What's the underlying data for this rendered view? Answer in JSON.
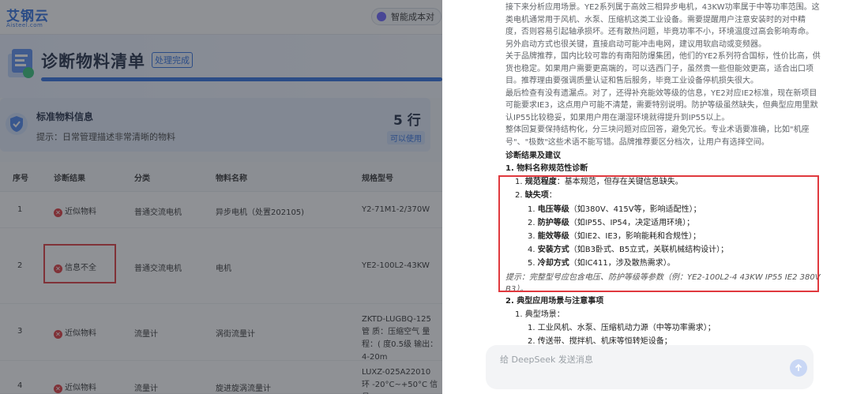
{
  "app": {
    "logo": "艾钢云",
    "logo_sub": "Aisteel.com",
    "ai_button": "智能成本对",
    "page_title": "诊断物料清单",
    "status_badge": "处理完成",
    "progress": 1.0
  },
  "info_card": {
    "title": "标准物料信息",
    "hint": "提示：日常管理描述非常清晰的物料",
    "count": "5 行",
    "usable": "可以使用"
  },
  "table": {
    "headers": [
      "序号",
      "诊断结果",
      "分类",
      "物料名称",
      "规格型号"
    ],
    "rows": [
      {
        "no": "1",
        "result": "近似物料",
        "category": "普通交流电机",
        "name": "异步电机（处置202105)",
        "spec": "Y2-71M1-2/370W"
      },
      {
        "no": "2",
        "result": "信息不全",
        "category": "普通交流电机",
        "name": "电机",
        "spec": "YE2-100L2-43KW"
      },
      {
        "no": "3",
        "result": "近似物料",
        "category": "流量计",
        "name": "涡街流量计",
        "spec": "ZKTD-LUGBQ-125 管 质：压缩空气 量程：( 度0.5级 输出：4-20m"
      },
      {
        "no": "4",
        "result": "近似物料",
        "category": "流量计",
        "name": "旋进旋涡流量计",
        "spec": "LUXZ-025A22010 环 -20°C~+50°C 信号 4"
      }
    ]
  },
  "chat": {
    "paragraphs": [
      "接下来分析应用场景。YE2系列属于高效三相异步电机，43KW功率属于中等功率范围。这",
      "类电机通常用于风机、水泵、压缩机这类工业设备。需要提醒用户注意安装时的对中精",
      "度，否则容易引起轴承损坏。还有散热问题，毕竟功率不小，环境温度过高会影响寿命。",
      "另外启动方式也很关键，直接启动可能冲击电网，建议用软启动或变频器。",
      "关于品牌推荐，国内比较可靠的有南阳防爆集团，他们的YE2系列符合国标，性价比高，供",
      "货也稳定。如果用户需要更高端的，可以选西门子，虽然贵一些但能效更高，适合出口项",
      "目。推荐理由要强调质量认证和售后服务，毕竟工业设备停机损失很大。",
      "最后检查有没有遗漏点。对了，还得补充能效等级的信息，YE2对应IE2标准，现在新项目",
      "可能要求IE3，这点用户可能不清楚，需要特别说明。防护等级虽然缺失，但典型应用里默",
      "认IP55比较稳妥，如果用户用在潮湿环境就得提升到IP55以上。",
      "整体回复要保持结构化，分三块问题对应回答，避免冗长。专业术语要准确，比如\"机座",
      "号\"、\"极数\"这些术语不能写错。品牌推荐要区分档次，让用户有选择空间。"
    ],
    "section_title": "诊断结果及建议",
    "sub1_title": "1. 物料名称规范性诊断",
    "norm_label": "规范程度",
    "norm_text": "：基本规范，但存在关键信息缺失。",
    "missing_label": "缺失项",
    "missing_items": [
      {
        "label": "电压等级",
        "text": "（如380V、415V等，影响适配性）；"
      },
      {
        "label": "防护等级",
        "text": "（如IP55、IP54，决定适用环境）；"
      },
      {
        "label": "能效等级",
        "text": "（如IE2、IE3，影响能耗和合规性）；"
      },
      {
        "label": "安装方式",
        "text": "（如B3卧式、B5立式，关联机械结构设计）；"
      },
      {
        "label": "冷却方式",
        "text": "（如IC411，涉及散热需求）。"
      }
    ],
    "hint_line1": "提示：完整型号应包含电压、防护等级等参数（例：YE2-100L2-4 43KW IP55 IE2 380V",
    "hint_line2": "B3）。",
    "sub2_title": "2. 典型应用场景与注意事项",
    "scene_label": "典型场景",
    "scene_items": [
      "工业风机、水泵、压缩机动力源（中等功率需求）；",
      "传送带、搅拌机、机床等恒转矩设备；"
    ],
    "composer_placeholder": "给 DeepSeek 发送消息"
  },
  "colors": {
    "accent": "#2f6fe0",
    "error": "#e0393e",
    "highlight_box": "#e0393e"
  }
}
